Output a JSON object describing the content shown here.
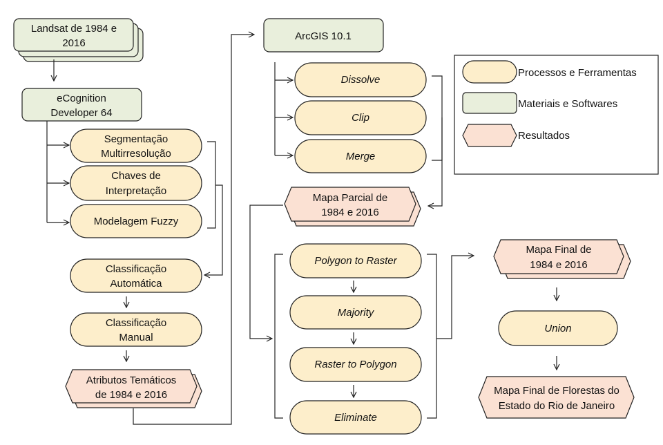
{
  "colors": {
    "process": "#fdeecb",
    "material": "#e9efdc",
    "result": "#fbe1d3"
  },
  "nodes": {
    "landsat": [
      "Landsat de 1984 e",
      "2016"
    ],
    "ecognition": [
      "eCognition",
      "Developer 64"
    ],
    "segmentacao": [
      "Segmentação",
      "Multirresolução"
    ],
    "chaves": [
      "Chaves de",
      "Interpretação"
    ],
    "fuzzy": "Modelagem Fuzzy",
    "class_auto": [
      "Classificação",
      "Automática"
    ],
    "class_manual": [
      "Classificação",
      "Manual"
    ],
    "atributos": [
      "Atributos Temáticos",
      "de 1984 e 2016"
    ],
    "arcgis": "ArcGIS 10.1",
    "dissolve": "Dissolve",
    "clip": "Clip",
    "merge": "Merge",
    "mapa_parcial": [
      "Mapa Parcial de",
      "1984 e 2016"
    ],
    "polygon_to_raster": "Polygon to Raster",
    "majority": "Majority",
    "raster_to_polygon": "Raster to Polygon",
    "eliminate": "Eliminate",
    "mapa_final": [
      "Mapa Final de",
      "1984 e 2016"
    ],
    "union": "Union",
    "mapa_florestas": [
      "Mapa Final de Florestas do",
      "Estado do Rio de Janeiro"
    ]
  },
  "legend": {
    "process": "Processos e Ferramentas",
    "material": "Materiais e Softwares",
    "result": "Resultados"
  }
}
